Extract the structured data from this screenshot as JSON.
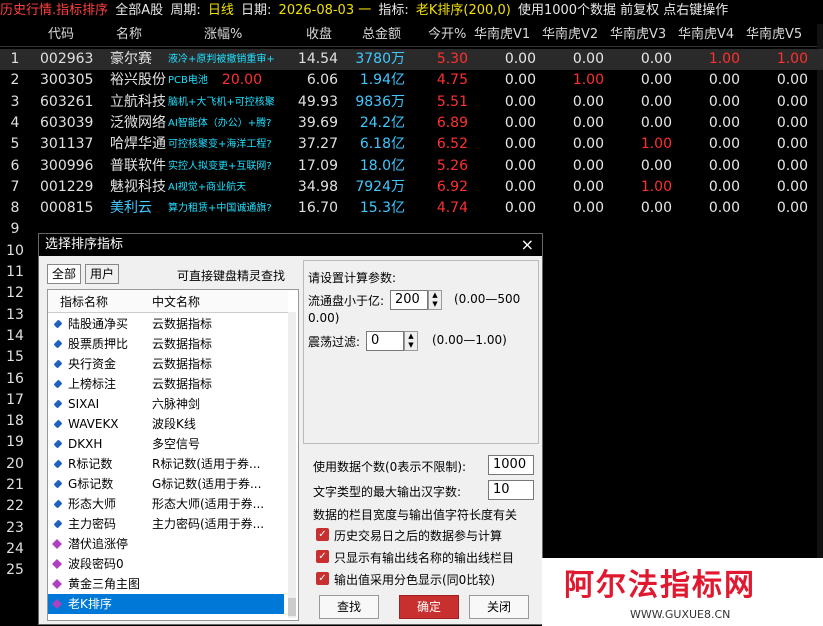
{
  "titlebar": {
    "module": "历史行情.指标排序",
    "market": "全部A股",
    "period_label": "周期:",
    "period": "日线",
    "date_label": "日期:",
    "date": "2026-08-03 一",
    "indicator_label": "指标:",
    "indicator": "老K排序(200,0)",
    "data_info": "使用1000个数据 前复权 点右键操作"
  },
  "columns": [
    "代码",
    "名称",
    "涨幅%",
    "收盘",
    "总金额",
    "今开%",
    "华南虎V1",
    "华南虎V2",
    "华南虎V3",
    "华南虎V4",
    "华南虎V5"
  ],
  "rows": [
    {
      "idx": "1",
      "code": "002963",
      "name": "豪尔赛",
      "note": "液冷+原判被撤销重审+",
      "chg": "",
      "close": "14.54",
      "cap": "3780万",
      "pct": "5.30",
      "v1": "0.00",
      "v2": "0.00",
      "v3": "0.00",
      "v4": "1.00",
      "v5": "1.00"
    },
    {
      "idx": "2",
      "code": "300305",
      "name": "裕兴股份",
      "note": "PCB电池",
      "chg": "20.00",
      "close": "6.06",
      "cap": "1.94亿",
      "pct": "4.75",
      "v1": "0.00",
      "v2": "1.00",
      "v3": "0.00",
      "v4": "0.00",
      "v5": "0.00"
    },
    {
      "idx": "3",
      "code": "603261",
      "name": "立航科技",
      "note": "脑机+大飞机+可控核聚",
      "chg": "",
      "close": "49.93",
      "cap": "9836万",
      "pct": "5.51",
      "v1": "0.00",
      "v2": "0.00",
      "v3": "0.00",
      "v4": "0.00",
      "v5": "0.00"
    },
    {
      "idx": "4",
      "code": "603039",
      "name": "泛微网络",
      "note": "AI智能体（办公）+腾?",
      "chg": "",
      "close": "39.69",
      "cap": "24.2亿",
      "pct": "6.89",
      "v1": "0.00",
      "v2": "0.00",
      "v3": "0.00",
      "v4": "0.00",
      "v5": "0.00"
    },
    {
      "idx": "5",
      "code": "301137",
      "name": "哈焊华通",
      "note": "可控核聚变+海洋工程?",
      "chg": "",
      "close": "37.27",
      "cap": "6.18亿",
      "pct": "6.52",
      "v1": "0.00",
      "v2": "0.00",
      "v3": "1.00",
      "v4": "0.00",
      "v5": "0.00"
    },
    {
      "idx": "6",
      "code": "300996",
      "name": "普联软件",
      "note": "实控人拟变更+互联网?",
      "chg": "",
      "close": "17.09",
      "cap": "18.0亿",
      "pct": "5.26",
      "v1": "0.00",
      "v2": "0.00",
      "v3": "0.00",
      "v4": "0.00",
      "v5": "0.00"
    },
    {
      "idx": "7",
      "code": "001229",
      "name": "魅视科技",
      "note": "AI视觉+商业航天",
      "chg": "",
      "close": "34.98",
      "cap": "7924万",
      "pct": "6.92",
      "v1": "0.00",
      "v2": "0.00",
      "v3": "1.00",
      "v4": "0.00",
      "v5": "0.00"
    },
    {
      "idx": "8",
      "code": "000815",
      "name": "美利云",
      "note": "算力租赁+中国诚通旗?",
      "chg": "",
      "close": "16.70",
      "cap": "15.3亿",
      "pct": "4.74",
      "v1": "0.00",
      "v2": "0.00",
      "v3": "0.00",
      "v4": "0.00",
      "v5": "0.00"
    }
  ],
  "extra_idx": [
    "9",
    "10",
    "11",
    "12",
    "13",
    "14",
    "15",
    "16",
    "17",
    "18",
    "19",
    "20",
    "21",
    "22",
    "23",
    "24",
    "25"
  ],
  "dialog": {
    "title": "选择排序指标",
    "close": "×",
    "tabs": [
      "全部",
      "用户"
    ],
    "hint": "可直接键盘精灵查找",
    "list_headers": [
      "指标名称",
      "中文名称"
    ],
    "items": [
      {
        "n": "陆股通净买",
        "cn": "云数据指标",
        "kind": "a"
      },
      {
        "n": "股票质押比",
        "cn": "云数据指标",
        "kind": "a"
      },
      {
        "n": "央行资金",
        "cn": "云数据指标",
        "kind": "a"
      },
      {
        "n": "上榜标注",
        "cn": "云数据指标",
        "kind": "a"
      },
      {
        "n": "SIXAI",
        "cn": "六脉神剑",
        "kind": "a"
      },
      {
        "n": "WAVEKX",
        "cn": "波段K线",
        "kind": "a"
      },
      {
        "n": "DKXH",
        "cn": "多空信号",
        "kind": "a"
      },
      {
        "n": "R标记数",
        "cn": "R标记数(适用于券...",
        "kind": "a"
      },
      {
        "n": "G标记数",
        "cn": "G标记数(适用于券...",
        "kind": "a"
      },
      {
        "n": "形态大师",
        "cn": "形态大师(适用于券...",
        "kind": "a"
      },
      {
        "n": "主力密码",
        "cn": "主力密码(适用于券...",
        "kind": "a"
      },
      {
        "n": "潜伏追涨停",
        "cn": "",
        "kind": "b"
      },
      {
        "n": "波段密码0",
        "cn": "",
        "kind": "b"
      },
      {
        "n": "黄金三角主图",
        "cn": "",
        "kind": "b"
      },
      {
        "n": "老K排序",
        "cn": "",
        "kind": "b"
      }
    ],
    "params_title": "请设置计算参数:",
    "param1_label": "流通盘小于亿:",
    "param1_value": "200",
    "param1_range": "(0.00—500",
    "param1_range2": "0.00)",
    "param2_label": "震荡过滤:",
    "param2_value": "0",
    "param2_range": "(0.00—1.00)",
    "data_count_label": "使用数据个数(0表示不限制):",
    "data_count": "1000",
    "max_chars_label": "文字类型的最大输出汉字数:",
    "max_chars": "10",
    "width_note": "数据的栏目宽度与输出值字符长度有关",
    "check1": "历史交易日之后的数据参与计算",
    "check2": "只显示有输出线名称的输出线栏目",
    "check3": "输出值采用分色显示(同0比较)",
    "btn_find": "查找",
    "btn_ok": "确定",
    "btn_close": "关闭"
  },
  "watermark": {
    "big": "阿尔法指标网",
    "small": "WWW.GUXUE8.CN"
  }
}
